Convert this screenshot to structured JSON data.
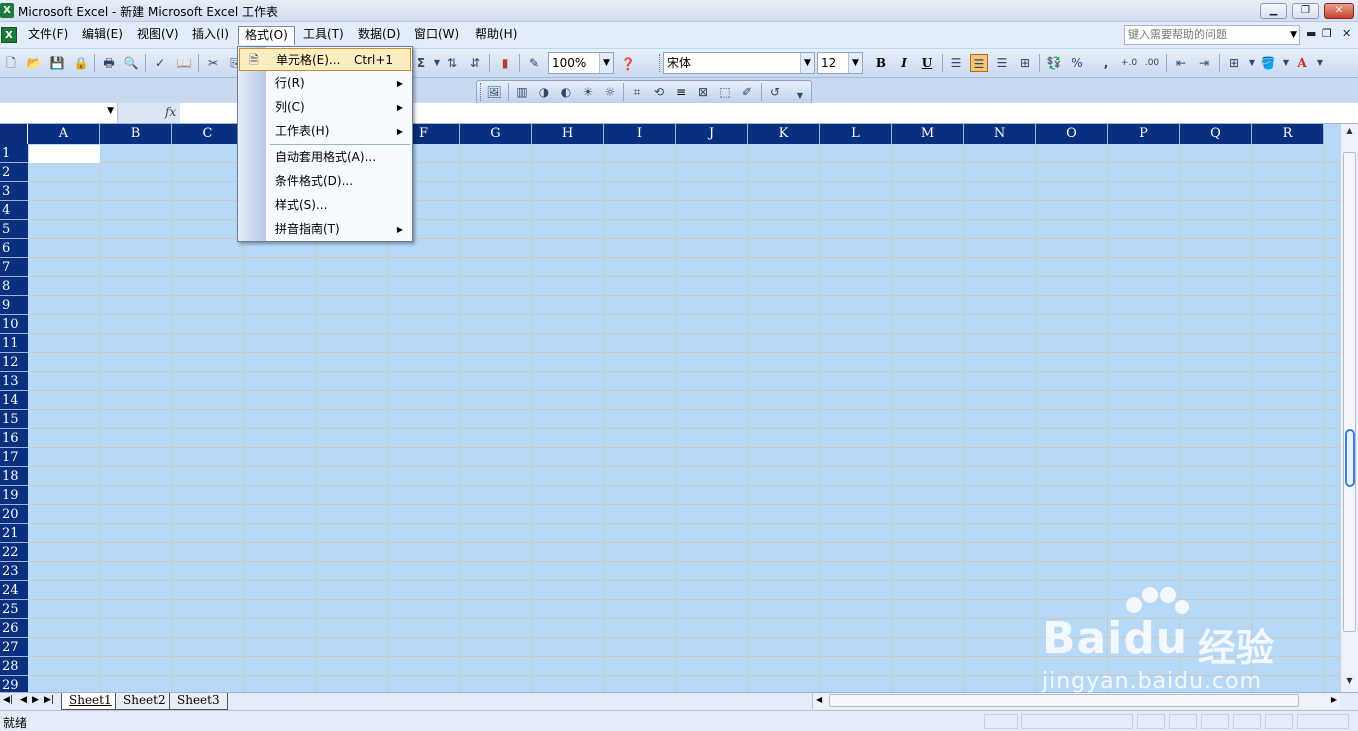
{
  "window": {
    "title": "Microsoft Excel - 新建 Microsoft Excel 工作表",
    "app_icon": "excel-icon",
    "buttons": [
      "minimize-icon",
      "restore-icon",
      "close-icon"
    ]
  },
  "menubar": {
    "items": [
      {
        "label": "文件(F)"
      },
      {
        "label": "编辑(E)"
      },
      {
        "label": "视图(V)"
      },
      {
        "label": "插入(I)"
      },
      {
        "label": "格式(O)",
        "active": true
      },
      {
        "label": "工具(T)"
      },
      {
        "label": "数据(D)"
      },
      {
        "label": "窗口(W)"
      },
      {
        "label": "帮助(H)"
      }
    ],
    "help_placeholder": "键入需要帮助的问题"
  },
  "toolbar": {
    "zoom": "100%",
    "font_name": "宋体",
    "font_size": "12",
    "bold": "B",
    "italic": "I",
    "underline": "U",
    "percent": "%",
    "comma": ",",
    "sum": "Σ"
  },
  "formula_bar": {
    "name_box": "",
    "fx_label": "fx",
    "content": ""
  },
  "grid": {
    "columns": [
      "A",
      "B",
      "C",
      "D",
      "E",
      "F",
      "G",
      "H",
      "I",
      "J",
      "K",
      "L",
      "M",
      "N",
      "O",
      "P",
      "Q",
      "R"
    ],
    "rows": [
      "1",
      "2",
      "3",
      "4",
      "5",
      "6",
      "7",
      "8",
      "9",
      "10",
      "11",
      "12",
      "13",
      "14",
      "15",
      "16",
      "17",
      "18",
      "19",
      "20",
      "21",
      "22",
      "23",
      "24",
      "25",
      "26",
      "27",
      "28",
      "29"
    ],
    "active_cell": "A1",
    "selection_color": "#b7d9f8",
    "header_color": "#08307f"
  },
  "format_menu": {
    "items": [
      {
        "label": "单元格(E)...",
        "shortcut": "Ctrl+1",
        "highlight": true,
        "icon": "format-cells-icon"
      },
      {
        "label": "行(R)",
        "submenu": true
      },
      {
        "label": "列(C)",
        "submenu": true
      },
      {
        "label": "工作表(H)",
        "submenu": true
      },
      {
        "label": "自动套用格式(A)..."
      },
      {
        "label": "条件格式(D)..."
      },
      {
        "label": "样式(S)..."
      },
      {
        "label": "拼音指南(T)",
        "submenu": true
      }
    ]
  },
  "sheets": {
    "tabs": [
      "Sheet1",
      "Sheet2",
      "Sheet3"
    ],
    "active": "Sheet1"
  },
  "status": {
    "text": "就绪"
  },
  "watermark": {
    "brand": "Bai",
    "brand_du": "du",
    "brand_cn": "经验",
    "url": "jingyan.baidu.com"
  }
}
